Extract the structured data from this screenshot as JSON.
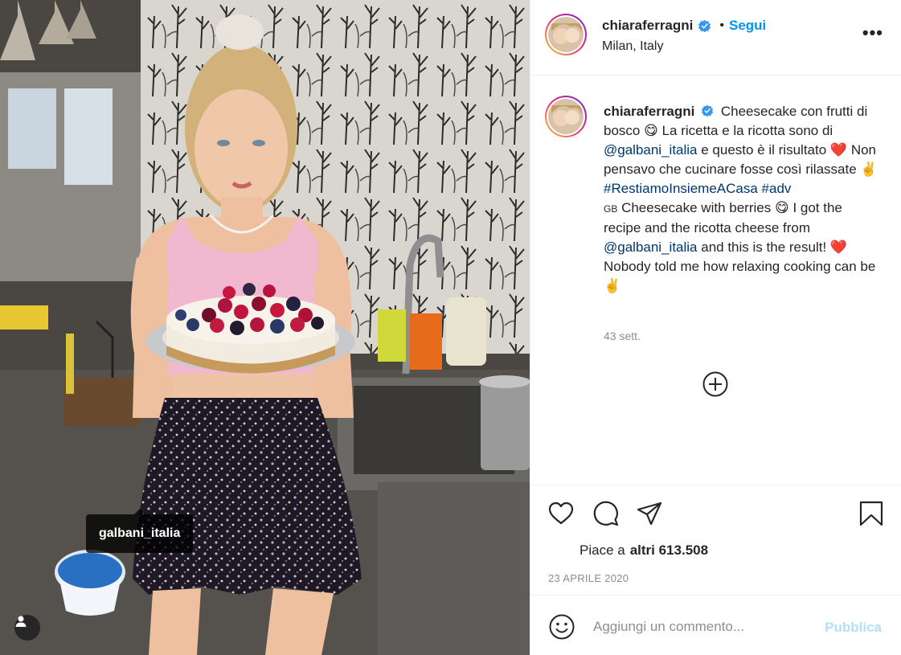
{
  "post": {
    "username": "chiaraferragni",
    "location": "Milan, Italy",
    "follow_label": "Segui",
    "separator": "•",
    "more_label": "•••"
  },
  "photo": {
    "tag_label": "galbani_italia"
  },
  "caption": {
    "username": "chiaraferragni",
    "part1": "Cheesecake con frutti di bosco",
    "emoji1": "😋",
    "part2": "La ricetta e la ricotta sono di",
    "mention1": "@galbani_italia",
    "part3": "e questo è il risultato",
    "emoji2": "❤️",
    "part4": "Non pensavo che cucinare fosse così rilassate",
    "emoji3": "✌️",
    "hashtag1": "#RestiamoInsiemeACasa",
    "hashtag2": "#adv",
    "flag": "GB",
    "part5": "Cheesecake with berries",
    "emoji4": "😋",
    "part6": "I got the recipe and the ricotta cheese from",
    "mention2": "@galbani_italia",
    "part7": "and this is the result!",
    "emoji5": "❤️",
    "part8": "Nobody told me how relaxing cooking can be",
    "emoji6": "✌️",
    "time_ago": "43 sett."
  },
  "actions": {
    "likes_prefix": "Piace a",
    "likes_count": "altri 613.508",
    "date": "23 APRILE 2020"
  },
  "comment": {
    "placeholder": "Aggiungi un commento...",
    "publish_label": "Pubblica"
  },
  "colors": {
    "accent": "#0095f6",
    "link": "#00376b",
    "publish_disabled": "#b2dffc",
    "muted": "#8e8e8e"
  }
}
